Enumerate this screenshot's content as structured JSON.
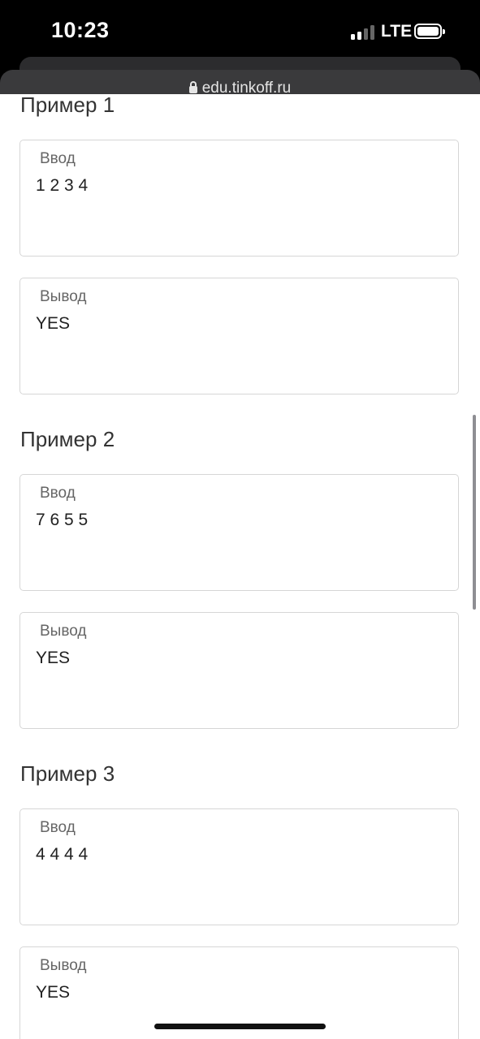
{
  "status_bar": {
    "time": "10:23",
    "network": "LTE",
    "signal_bars_active": 2,
    "signal_bars_total": 4,
    "battery_icon": "battery-full-icon"
  },
  "browser": {
    "url": "edu.tinkoff.ru",
    "lock_icon": "lock-icon"
  },
  "examples": [
    {
      "title": "Пример 1",
      "input_label": "Ввод",
      "input_value": "1 2 3 4",
      "output_label": "Вывод",
      "output_value": "YES"
    },
    {
      "title": "Пример 2",
      "input_label": "Ввод",
      "input_value": "7 6 5 5",
      "output_label": "Вывод",
      "output_value": "YES"
    },
    {
      "title": "Пример 3",
      "input_label": "Ввод",
      "input_value": "4 4 4 4",
      "output_label": "Вывод",
      "output_value": "YES"
    }
  ],
  "colors": {
    "background": "#ffffff",
    "status_bar": "#000000",
    "border": "#d6d6d6"
  }
}
